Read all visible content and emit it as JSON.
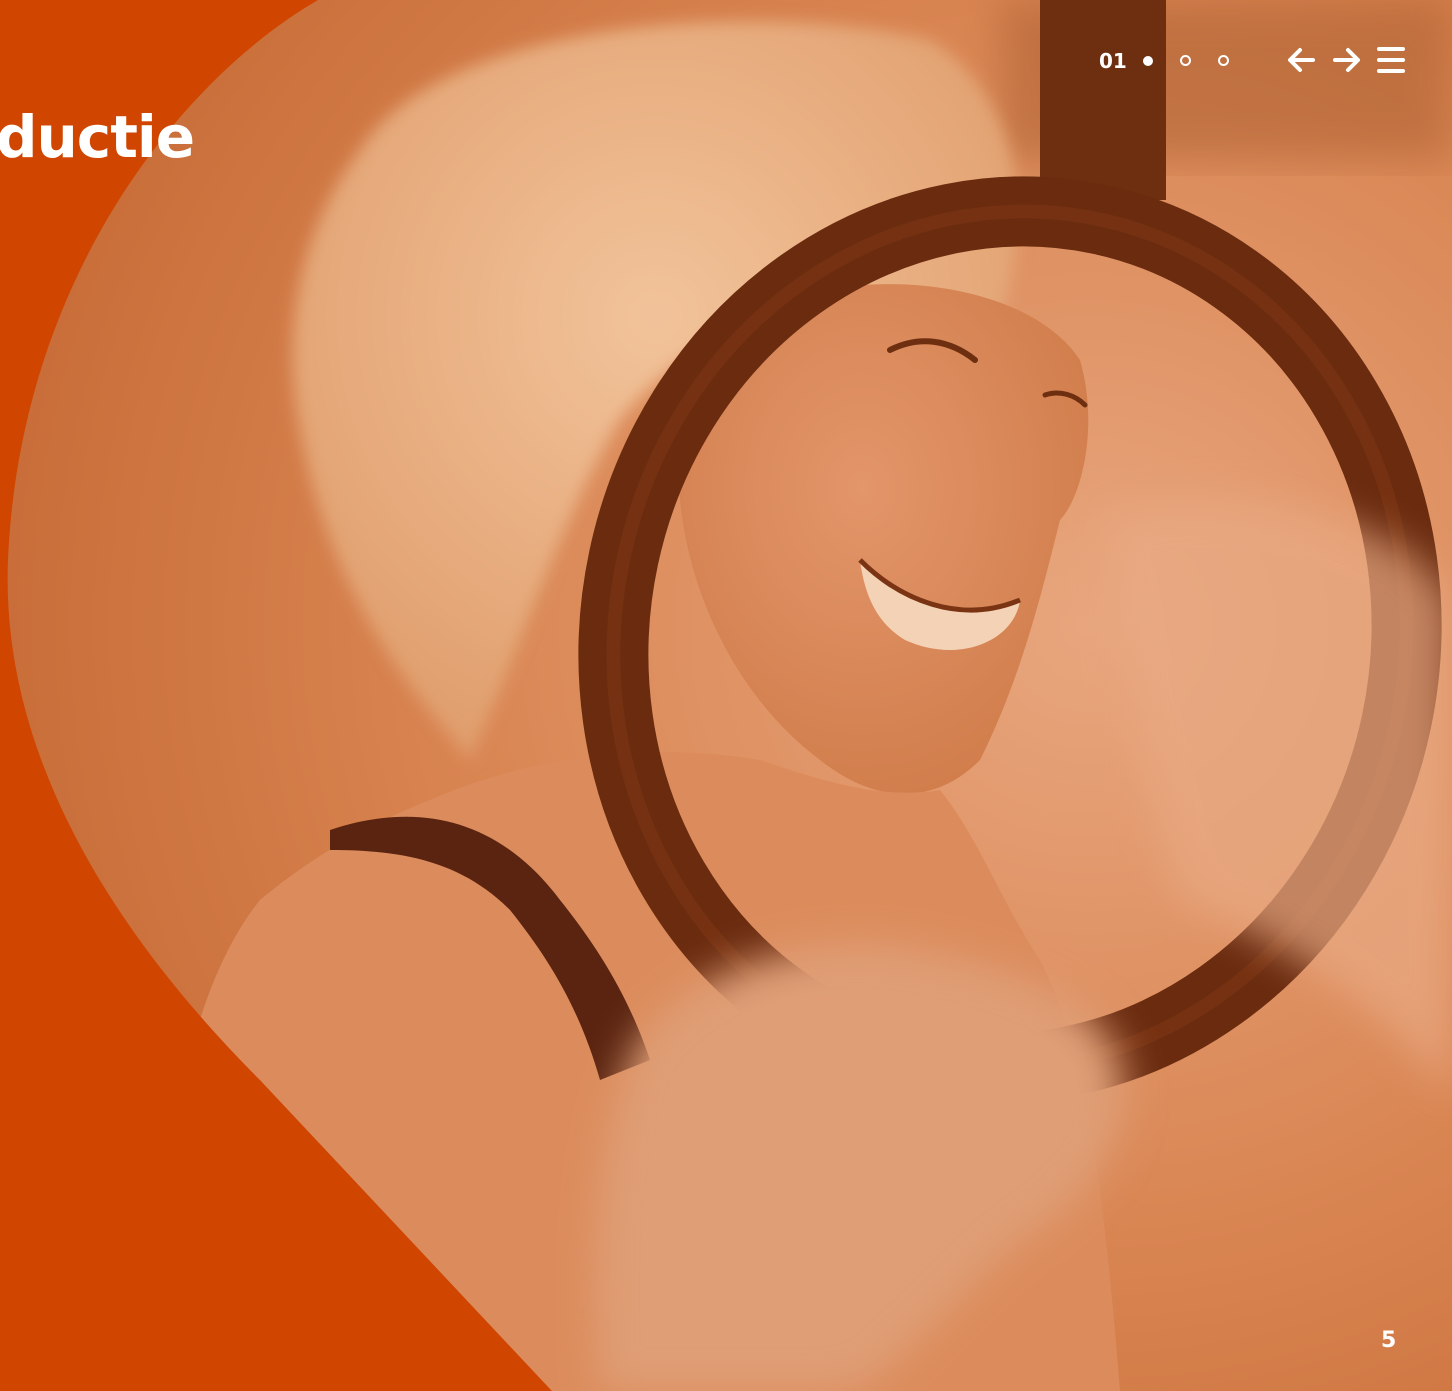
{
  "header": {
    "title": "ductie",
    "page_counter": "01",
    "pagination_dots": [
      {
        "state": "active"
      },
      {
        "state": "inactive"
      },
      {
        "state": "inactive"
      }
    ],
    "icons": {
      "previous": "arrow-left-icon",
      "next": "arrow-right-icon",
      "menu": "hamburger-menu-icon"
    }
  },
  "footer": {
    "page_number": "5"
  },
  "colors": {
    "brand_orange": "#d04600",
    "photo_tint": "#d98552",
    "text": "#ffffff"
  }
}
